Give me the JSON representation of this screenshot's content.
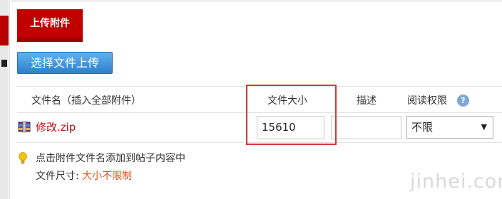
{
  "section": {
    "title": "上传附件"
  },
  "upload": {
    "button_label": "选择文件上传"
  },
  "table": {
    "headers": {
      "name": "文件名（插入全部附件）",
      "size": "文件大小",
      "desc": "描述",
      "perm": "阅读权限"
    },
    "rows": [
      {
        "file_name": "修改.zip",
        "size": "15610",
        "description": "",
        "permission": "不限"
      }
    ]
  },
  "tips": {
    "hint": "点击附件文件名添加到帖子内容中",
    "limit_label": "文件尺寸: ",
    "limit_value": "大小不限制"
  },
  "icons": {
    "help": "question-icon",
    "archive": "archive-icon",
    "tip": "lightbulb-icon",
    "select_arrow": "chevron-down-icon"
  },
  "colors": {
    "brand_red": "#c00000",
    "button_blue": "#2f7fcb",
    "link_red": "#c21212",
    "highlight_red": "#d43a3a",
    "limit_orange": "#e0531a"
  },
  "watermark": "jinhei.com"
}
